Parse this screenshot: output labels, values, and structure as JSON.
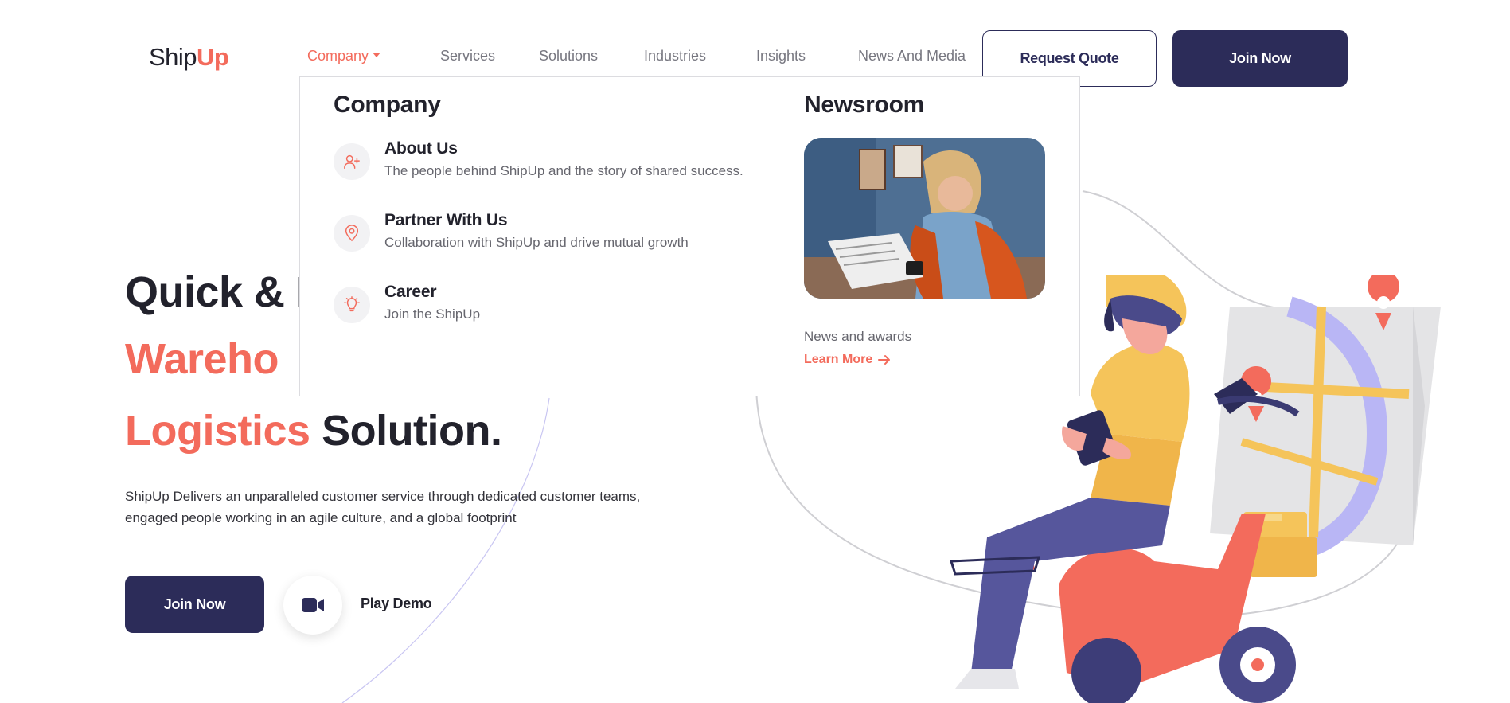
{
  "brand": {
    "logo_part1": "Ship",
    "logo_part2": "Up"
  },
  "nav": {
    "items": [
      {
        "label": "Company",
        "active": true
      },
      {
        "label": "Services"
      },
      {
        "label": "Solutions"
      },
      {
        "label": "Industries"
      },
      {
        "label": "Insights"
      },
      {
        "label": "News And Media"
      }
    ],
    "request_quote": "Request Quote",
    "join_now": "Join Now"
  },
  "dropdown": {
    "company_heading": "Company",
    "items": [
      {
        "title": "About Us",
        "description": "The people behind ShipUp and the story of shared success.",
        "icon": "user-plus-icon"
      },
      {
        "title": "Partner With Us",
        "description": "Collaboration with ShipUp and drive mutual growth",
        "icon": "map-pin-icon"
      },
      {
        "title": "Career",
        "description": "Join the ShipUp",
        "icon": "lightbulb-icon"
      }
    ],
    "newsroom_heading": "Newsroom",
    "news_caption": "News and awards",
    "learn_more": "Learn More"
  },
  "hero": {
    "line1": "Quick & R",
    "line2": "Wareho",
    "line3_accent": "Logistics",
    "line3_dark": "Solution.",
    "description": "ShipUp Delivers an unparalleled customer service through dedicated customer teams, engaged people working in an agile culture, and a global footprint",
    "join_now": "Join Now",
    "play_demo": "Play Demo"
  },
  "colors": {
    "accent": "#f36b5c",
    "navy": "#2c2c59",
    "text": "#22222c",
    "muted": "#777780"
  }
}
